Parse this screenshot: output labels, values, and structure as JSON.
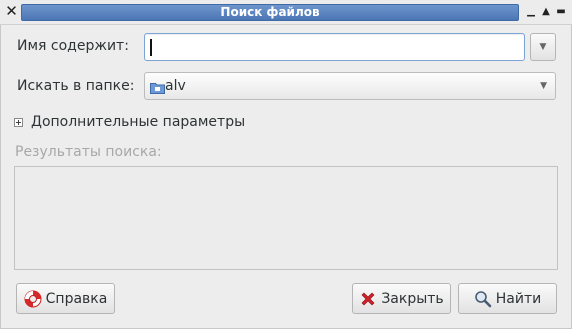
{
  "window": {
    "title": "Поиск файлов",
    "buttons": [
      "minimize",
      "maximize"
    ]
  },
  "form": {
    "name_label": "Имя содержит:",
    "name_value": "",
    "folder_label": "Искать в папке:",
    "folder_value": "alv",
    "more_options": "Дополнительные параметры",
    "results_label": "Результаты поиска:"
  },
  "buttons": {
    "help": "Справка",
    "close": "Закрыть",
    "find": "Найти"
  },
  "icons": {
    "help": "lifebuoy-icon",
    "close": "red-x-icon",
    "find": "magnifier-icon",
    "folder": "home-folder-icon"
  },
  "colors": {
    "titlebar_accent": "#4c77b5",
    "entry_focus": "#7ea3d6"
  }
}
